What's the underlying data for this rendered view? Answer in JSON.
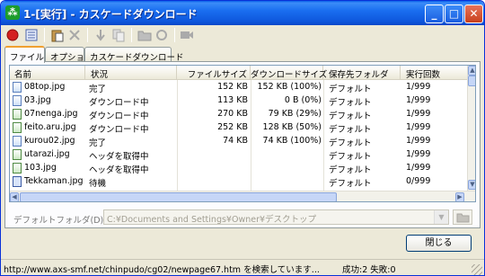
{
  "window": {
    "title": "1-[実行] - カスケードダウンロード"
  },
  "tabs": [
    {
      "label": "ファイル"
    },
    {
      "label": "オプション"
    },
    {
      "label": "カスケードダウンロード"
    }
  ],
  "table": {
    "columns": [
      "名前",
      "状況",
      "ファイルサイズ",
      "ダウンロードサイズ",
      "保存先フォルダ",
      "実行回数"
    ],
    "rows": [
      {
        "name": "08top.jpg",
        "status": "完了",
        "size": "152 KB",
        "downloaded": "152 KB (100%)",
        "folder": "デフォルト",
        "runs": "1/999",
        "icon": "file-icon"
      },
      {
        "name": "03.jpg",
        "status": "ダウンロード中",
        "size": "113 KB",
        "downloaded": "0 B (0%)",
        "folder": "デフォルト",
        "runs": "1/999",
        "icon": "file-icon"
      },
      {
        "name": "07nenga.jpg",
        "status": "ダウンロード中",
        "size": "270 KB",
        "downloaded": "79 KB (29%)",
        "folder": "デフォルト",
        "runs": "1/999",
        "icon": "download-file-icon"
      },
      {
        "name": "feito.aru.jpg",
        "status": "ダウンロード中",
        "size": "252 KB",
        "downloaded": "128 KB (50%)",
        "folder": "デフォルト",
        "runs": "1/999",
        "icon": "download-file-icon"
      },
      {
        "name": "kurou02.jpg",
        "status": "完了",
        "size": "74 KB",
        "downloaded": "74 KB (100%)",
        "folder": "デフォルト",
        "runs": "1/999",
        "icon": "file-icon"
      },
      {
        "name": "utarazi.jpg",
        "status": "ヘッダを取得中",
        "size": "",
        "downloaded": "",
        "folder": "デフォルト",
        "runs": "1/999",
        "icon": "download-file-icon"
      },
      {
        "name": "103.jpg",
        "status": "ヘッダを取得中",
        "size": "",
        "downloaded": "",
        "folder": "デフォルト",
        "runs": "1/999",
        "icon": "download-file-icon"
      },
      {
        "name": "Tekkaman.jpg",
        "status": "待機",
        "size": "",
        "downloaded": "",
        "folder": "デフォルト",
        "runs": "0/999",
        "icon": "hourglass-icon"
      }
    ]
  },
  "folder": {
    "label": "デフォルトフォルダ(D):",
    "value": "C:¥Documents and Settings¥Owner¥デスクトップ"
  },
  "buttons": {
    "close": "閉じる"
  },
  "status": {
    "message": "http://www.axs-smf.net/chinpudo/cg02/newpage67.htm を検索しています...",
    "counts": "成功:2 失敗:0"
  }
}
